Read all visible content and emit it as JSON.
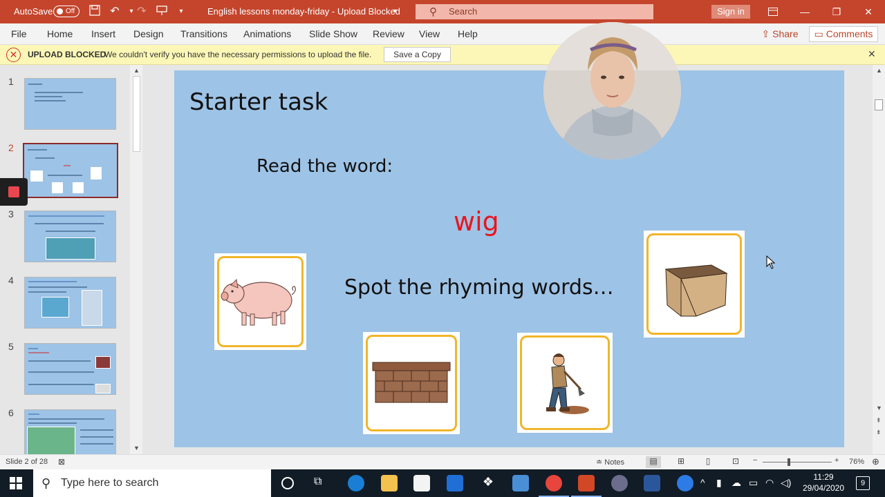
{
  "titlebar": {
    "autosave_label": "AutoSave",
    "autosave_state": "Off",
    "doc_title": "English lessons monday-friday  -  Upload Blocked",
    "search_placeholder": "Search",
    "signin_label": "Sign in"
  },
  "ribbon": {
    "tabs": [
      "File",
      "Home",
      "Insert",
      "Design",
      "Transitions",
      "Animations",
      "Slide Show",
      "Review",
      "View",
      "Help"
    ],
    "share_label": "Share",
    "comments_label": "Comments"
  },
  "infobar": {
    "title": "UPLOAD BLOCKED",
    "message": "We couldn't verify you have the necessary permissions to upload the file.",
    "button": "Save a Copy"
  },
  "thumbnails": [
    "1",
    "2",
    "3",
    "4",
    "5",
    "6"
  ],
  "slide": {
    "title": "Starter task",
    "instruction": "Read the word:",
    "word": "wig",
    "prompt": "Spot the rhyming words…",
    "cards": [
      "pig-image",
      "wall-image",
      "digging-man-image",
      "box-image"
    ]
  },
  "statusbar": {
    "slide_count": "Slide 2 of 28",
    "notes_label": "Notes",
    "zoom": "76%"
  },
  "taskbar": {
    "search_placeholder": "Type here to search",
    "time": "11:29",
    "date": "29/04/2020",
    "notifications": "9"
  },
  "colors": {
    "ppt_accent": "#c4452c",
    "slide_bg": "#9dc3e6",
    "word_red": "#e8161d",
    "card_border": "#f0b52a"
  }
}
